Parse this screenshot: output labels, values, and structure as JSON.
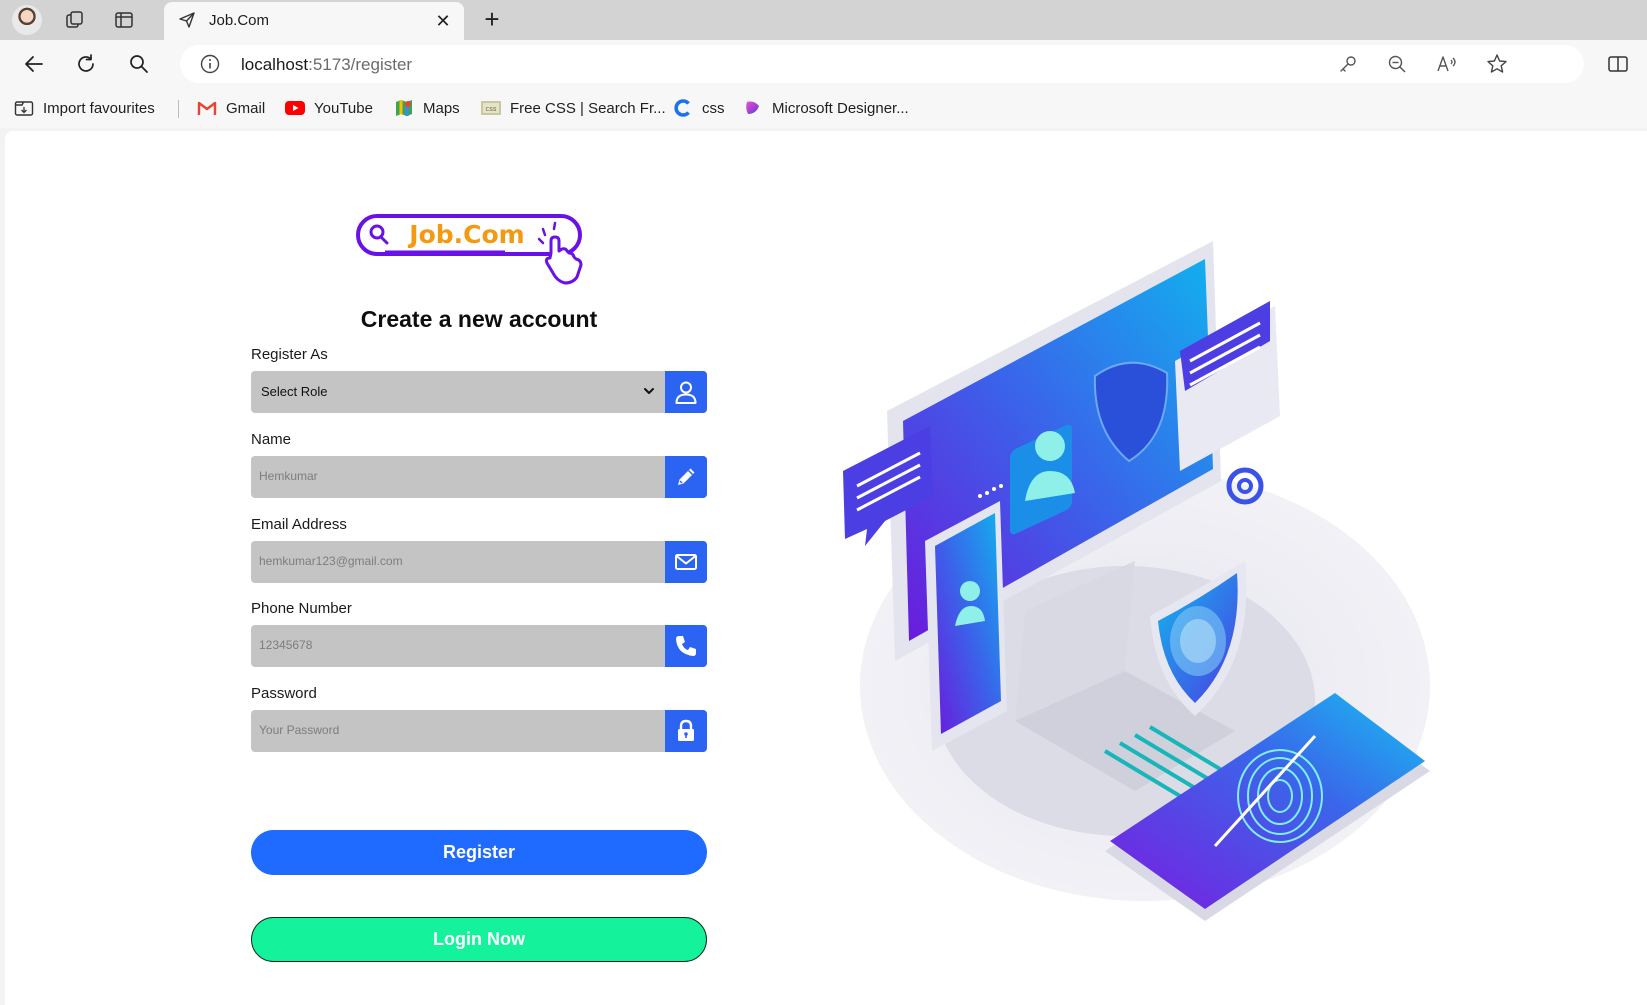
{
  "browser": {
    "tab_title": "Job.Com",
    "tab_close": "✕",
    "new_tab": "+",
    "url_host": "localhost",
    "url_path": ":5173/register",
    "bookmarks": [
      {
        "label": "Import favourites",
        "icon": "import-icon"
      },
      {
        "label": "Gmail",
        "icon": "gmail-icon"
      },
      {
        "label": "YouTube",
        "icon": "youtube-icon"
      },
      {
        "label": "Maps",
        "icon": "maps-icon"
      },
      {
        "label": "Free CSS | Search Fr...",
        "icon": "freecss-icon"
      },
      {
        "label": "css",
        "icon": "css-icon"
      },
      {
        "label": "Microsoft Designer...",
        "icon": "designer-icon"
      }
    ]
  },
  "page": {
    "logo_text": "Job.Com",
    "heading": "Create a new account",
    "fields": {
      "role": {
        "label": "Register As",
        "value": "Select Role",
        "icon": "user-icon"
      },
      "name": {
        "label": "Name",
        "placeholder": "Hemkumar",
        "icon": "pencil-icon"
      },
      "email": {
        "label": "Email Address",
        "placeholder": "hemkumar123@gmail.com",
        "icon": "mail-icon"
      },
      "phone": {
        "label": "Phone Number",
        "placeholder": "12345678",
        "icon": "phone-icon"
      },
      "password": {
        "label": "Password",
        "placeholder": "Your Password",
        "icon": "lock-icon"
      }
    },
    "register_button": "Register",
    "login_button": "Login Now"
  },
  "colors": {
    "accent_blue": "#2b63f2",
    "register_button": "#1f6bff",
    "login_button": "#14f29b",
    "input_bg": "#c4c4c4",
    "logo_purple": "#6a11e8",
    "logo_orange": "#f39a12"
  }
}
